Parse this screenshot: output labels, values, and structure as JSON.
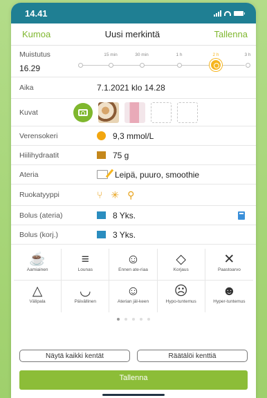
{
  "status": {
    "time": "14.41"
  },
  "nav": {
    "cancel": "Kumoa",
    "title": "Uusi merkintä",
    "save": "Tallenna"
  },
  "reminder": {
    "label": "Muistutus",
    "time": "16.29",
    "options": [
      "15 min",
      "30 min",
      "1 h",
      "2 h",
      "3 h"
    ],
    "selected": "2 h"
  },
  "time_row": {
    "label": "Aika",
    "value": "7.1.2021 klo 14.28"
  },
  "photos": {
    "label": "Kuvat"
  },
  "blood_sugar": {
    "label": "Verensokeri",
    "value": "9,3 mmol/L",
    "color": "#f2a60f"
  },
  "carbs": {
    "label": "Hiilihydraatit",
    "value": "75  g",
    "color": "#c4871b"
  },
  "meal": {
    "label": "Ateria",
    "value": "Leipä, puuro, smoothie"
  },
  "food_type": {
    "label": "Ruokatyyppi"
  },
  "bolus_meal": {
    "label": "Bolus (ateria)",
    "value": "8 Yks.",
    "color": "#2a8dbf"
  },
  "bolus_corr": {
    "label": "Bolus (korj.)",
    "value": "3 Yks.",
    "color": "#2a8dbf"
  },
  "categories": [
    {
      "label": "Aamiainen",
      "icon": "breakfast-icon",
      "selected": true
    },
    {
      "label": "Lounas",
      "icon": "lunch-icon",
      "selected": false
    },
    {
      "label": "Ennen ate-riaa",
      "icon": "before-meal-icon",
      "selected": false
    },
    {
      "label": "Korjaus",
      "icon": "correction-icon",
      "selected": false
    },
    {
      "label": "Paastoarvo",
      "icon": "fasting-icon",
      "selected": false
    },
    {
      "label": "Välipala",
      "icon": "snack-icon",
      "selected": false
    },
    {
      "label": "Päivällinen",
      "icon": "dinner-icon",
      "selected": false
    },
    {
      "label": "Aterian jäl-keen",
      "icon": "after-meal-icon",
      "selected": false
    },
    {
      "label": "Hypo-tuntemus",
      "icon": "hypo-icon",
      "selected": false
    },
    {
      "label": "Hyper-tuntemus",
      "icon": "hyper-icon",
      "selected": false
    }
  ],
  "buttons": {
    "show_all": "Näytä kaikki kentät",
    "customize": "Räätälöi kenttiä",
    "save": "Tallenna"
  },
  "colors": {
    "accent": "#7fb72e",
    "statusbar": "#1f7f93"
  }
}
